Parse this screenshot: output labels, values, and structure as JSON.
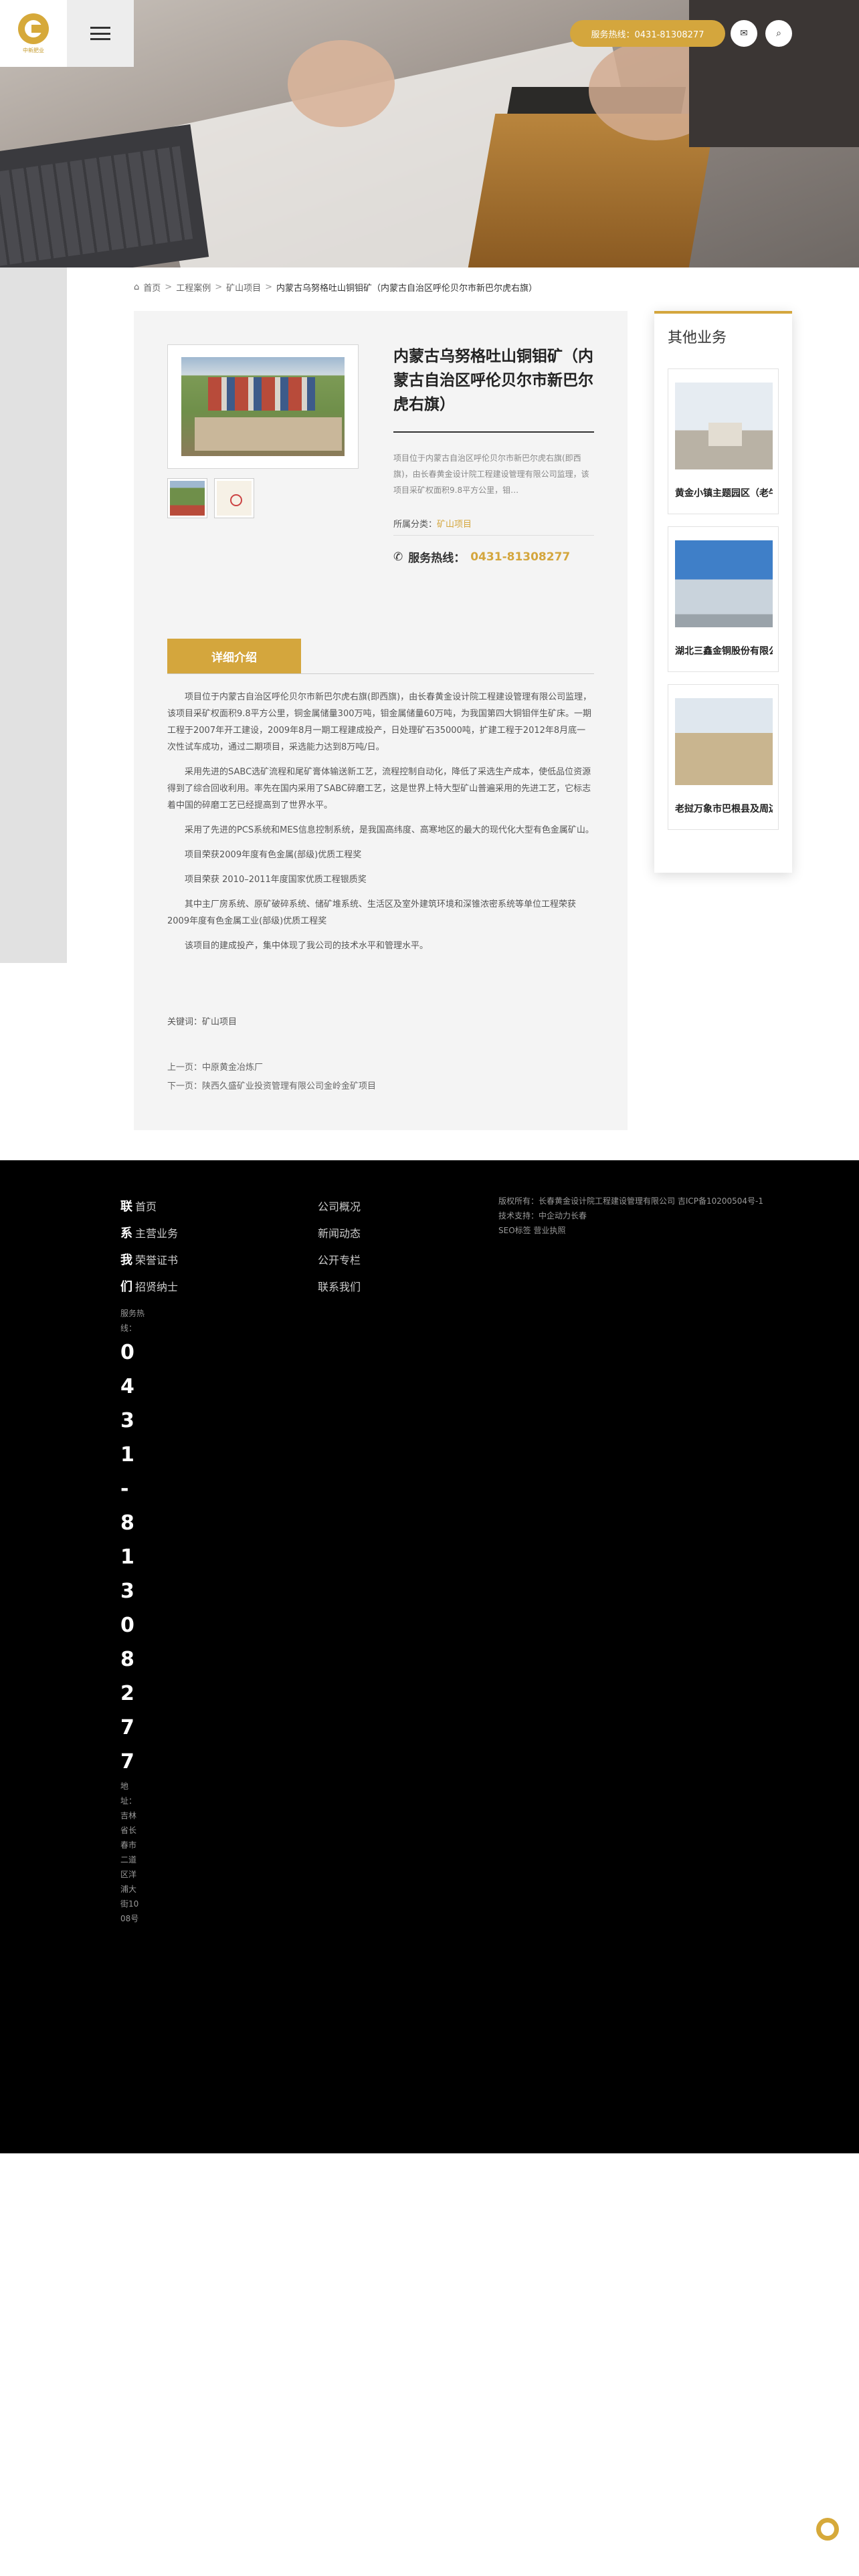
{
  "header": {
    "logo_text": "中新肥业",
    "hotline_pill": "服务热线：0431-81308277",
    "mail_icon": "✉",
    "search_icon": "⌕"
  },
  "breadcrumb": {
    "home": "首页",
    "level1": "工程案例",
    "level2": "矿山项目",
    "current": "内蒙古乌努格吐山铜钼矿（内蒙古自治区呼伦贝尔市新巴尔虎右旗）"
  },
  "project": {
    "title": "内蒙古乌努格吐山铜钼矿（内蒙古自治区呼伦贝尔市新巴尔虎右旗）",
    "summary": "项目位于内蒙古自治区呼伦贝尔市新巴尔虎右旗(即西旗)，由长春黄金设计院工程建设管理有限公司监理，该项目采矿权面积9.8平方公里，钼…",
    "category_label": "所属分类：",
    "category_value": "矿山项目",
    "service_label": "服务热线：",
    "service_phone": "0431-81308277"
  },
  "tab": {
    "label": "详细介绍"
  },
  "content": {
    "p1": "项目位于内蒙古自治区呼伦贝尔市新巴尔虎右旗(即西旗)，由长春黄金设计院工程建设管理有限公司监理，该项目采矿权面积9.8平方公里，铜金属储量300万吨，钼金属储量60万吨，为我国第四大铜钼伴生矿床。一期工程于2007年开工建设，2009年8月一期工程建成投产，日处理矿石35000吨，扩建工程于2012年8月底一次性试车成功，通过二期项目，采选能力达到8万吨/日。",
    "p2": "采用先进的SABC选矿流程和尾矿膏体输送新工艺，流程控制自动化，降低了采选生产成本，使低品位资源得到了综合回收利用。率先在国内采用了SABC碎磨工艺，这是世界上特大型矿山普遍采用的先进工艺，它标志着中国的碎磨工艺已经提高到了世界水平。",
    "p3": "采用了先进的PCS系统和MES信息控制系统，是我国高纬度、高寒地区的最大的现代化大型有色金属矿山。",
    "p4": "项目荣获2009年度有色金属(部级)优质工程奖",
    "p5": "项目荣获 2010–2011年度国家优质工程银质奖",
    "p6": "其中主厂房系统、原矿破碎系统、储矿堆系统、生活区及室外建筑环境和深锥浓密系统等单位工程荣获2009年度有色金属工业(部级)优质工程奖",
    "p7": "该项目的建成投产，集中体现了我公司的技术水平和管理水平。",
    "keywords": "关键词：矿山项目",
    "prev": "上一页：中原黄金冶炼厂",
    "next": "下一页：陕西久盛矿业投资管理有限公司金岭金矿项目"
  },
  "sidebar": {
    "title": "其他业务",
    "items": [
      {
        "caption": "黄金小镇主题园区（老牛…"
      },
      {
        "caption": "湖北三鑫金铜股份有限公司"
      },
      {
        "caption": "老挝万象市巴根县及周边…"
      }
    ]
  },
  "footer": {
    "nav_contact_chars": [
      "联",
      "系",
      "我",
      "们"
    ],
    "nav_col1": [
      "首页",
      "主营业务",
      "荣誉证书",
      "招贤纳士"
    ],
    "nav_col2": [
      "公司概况",
      "新闻动态",
      "公开专栏",
      "联系我们"
    ],
    "copyright": "版权所有：长春黄金设计院工程建设管理有限公司  吉ICP备10200504号-1",
    "tech": "技术支持：中企动力长春",
    "seo": "SEO标签   营业执照",
    "hotline_label": "服务热线：",
    "hotline_digits": [
      "0",
      "4",
      "3",
      "1",
      "-",
      "8",
      "1",
      "3",
      "0",
      "8",
      "2",
      "7",
      "7"
    ],
    "address": "地址：吉林省长春市二道区洋浦大街1008号"
  }
}
